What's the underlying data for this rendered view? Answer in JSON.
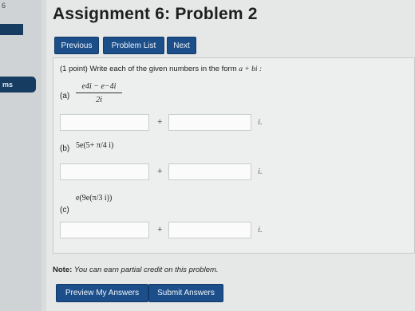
{
  "sidebar": {
    "number": "6",
    "item_label": "ms"
  },
  "header": {
    "title": "Assignment 6: Problem 2"
  },
  "nav": {
    "previous": "Previous",
    "problem_list": "Problem List",
    "next": "Next"
  },
  "problem": {
    "points": "(1 point)",
    "prompt": "Write each of the given numbers in the form",
    "form": "a + bi :",
    "parts": [
      {
        "label": "(a)",
        "numerator": "e4i − e−4i",
        "denominator": "2i",
        "real": "",
        "imag": "",
        "plus": "+",
        "i": "i."
      },
      {
        "label": "(b)",
        "expression": "5e(5+ π/4 i)",
        "real": "",
        "imag": "",
        "plus": "+",
        "i": "i."
      },
      {
        "label": "(c)",
        "expression": "e(9e(π/3 i))",
        "real": "",
        "imag": "",
        "plus": "+",
        "i": "i."
      }
    ]
  },
  "note": {
    "label": "Note:",
    "text": "You can earn partial credit on this problem."
  },
  "buttons": {
    "preview": "Preview My Answers",
    "submit": "Submit Answers"
  }
}
